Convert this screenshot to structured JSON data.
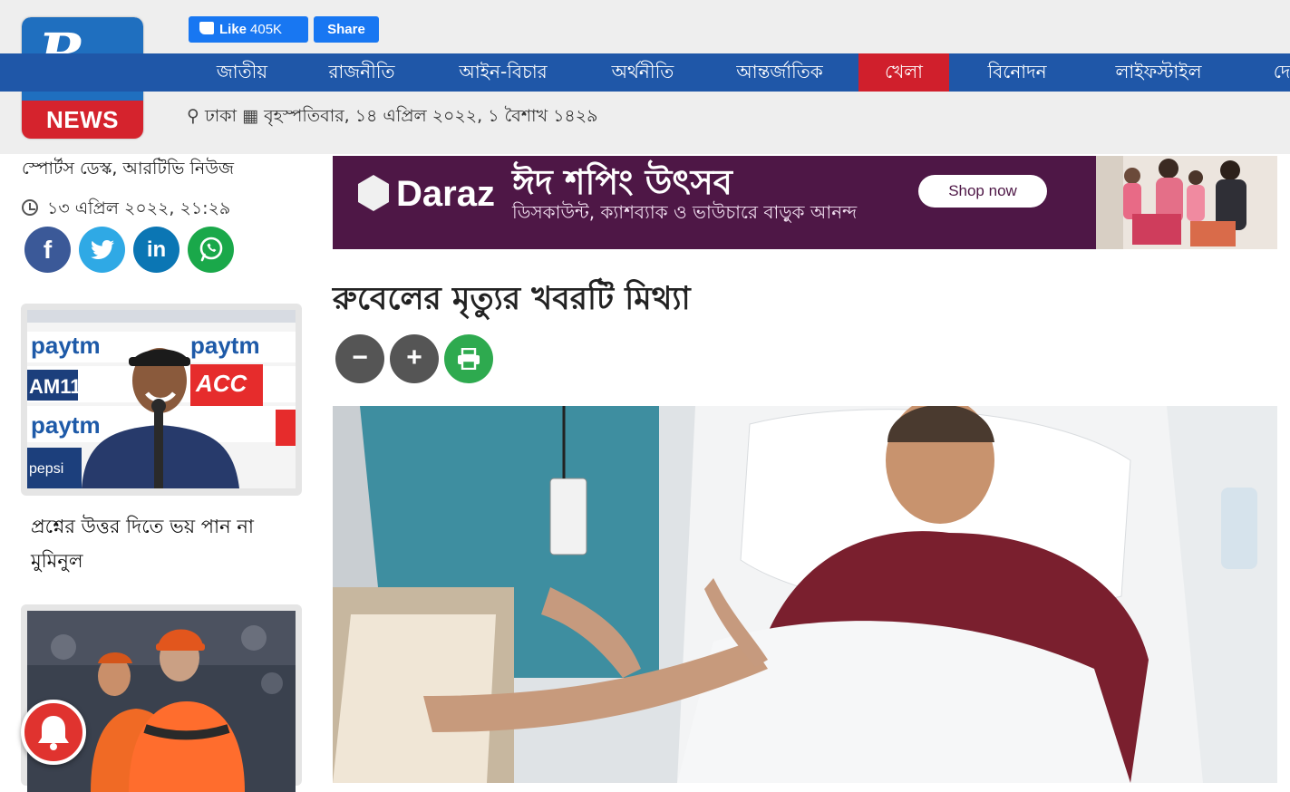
{
  "colors": {
    "nav_blue": "#1f57a8",
    "nav_active_red": "#d01f2c",
    "facebook_blue": "#1877f2",
    "print_green": "#2eaa4f",
    "ad_purple": "#4e1746"
  },
  "header": {
    "logo": {
      "mark": "Rtv",
      "news": "NEWS"
    },
    "facebook": {
      "like_label": "Like",
      "like_count": "405K",
      "share_label": "Share"
    },
    "nav": [
      {
        "label": "জাতীয়",
        "active": false
      },
      {
        "label": "রাজনীতি",
        "active": false
      },
      {
        "label": "আইন-বিচার",
        "active": false
      },
      {
        "label": "অর্থনীতি",
        "active": false
      },
      {
        "label": "আন্তর্জাতিক",
        "active": false
      },
      {
        "label": "খেলা",
        "active": true
      },
      {
        "label": "বিনোদন",
        "active": false
      },
      {
        "label": "লাইফস্টাইল",
        "active": false
      },
      {
        "label": "দে",
        "active": false
      }
    ],
    "location": "ঢাকা",
    "date": "বৃহস্পতিবার, ১৪ এপ্রিল ২০২২, ১ বৈশাখ ১৪২৯"
  },
  "article": {
    "reporter": "স্পোর্টস ডেস্ক, আরটিভি নিউজ",
    "published": "১৩ এপ্রিল ২০২২, ২১:২৯",
    "title": "রুবেলের মৃত্যুর খবরটি মিথ্যা",
    "controls": {
      "decrease": "−",
      "increase": "+"
    }
  },
  "ad": {
    "brand": "Daraz",
    "headline": "ঈদ শপিং উৎসব",
    "subline": "ডিসকাউন্ট, ক্যাশব্যাক ও ভাউচারে বাড়ুক আনন্দ",
    "button": "Shop now"
  },
  "sidebar": {
    "related": [
      {
        "title": "প্রশ্নের উত্তর দিতে ভয় পান না মুমিনুল"
      }
    ],
    "card1_sponsor_words": [
      "paytm",
      "ACC",
      "AM11",
      "pepsi"
    ]
  }
}
